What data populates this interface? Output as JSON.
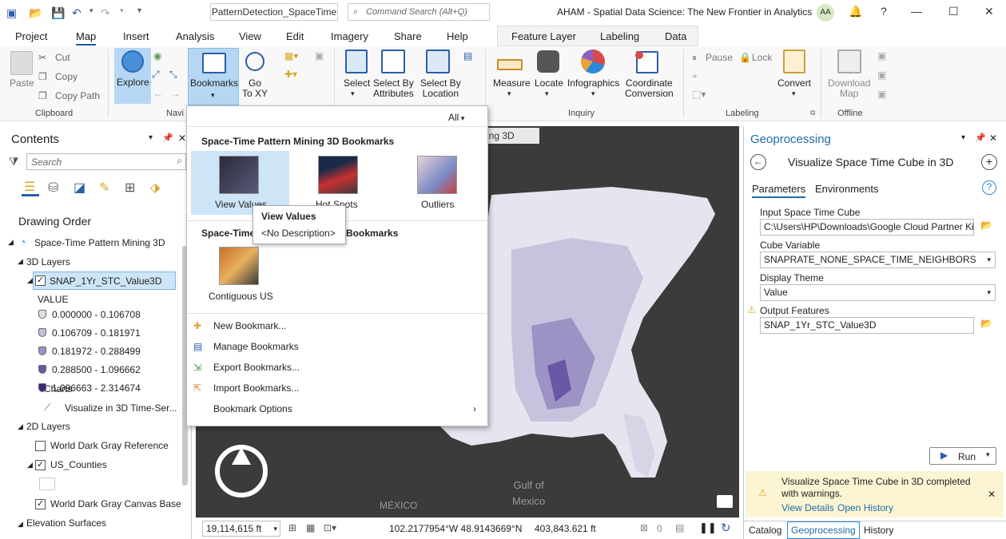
{
  "titlebar": {
    "doc_title": "PatternDetection_SpaceTime",
    "search_placeholder": "Command Search (Alt+Q)",
    "app_title": "AHAM - Spatial Data Science: The New Frontier in Analytics",
    "avatar": "AA",
    "help": "?"
  },
  "menu": {
    "tabs": [
      "Project",
      "Map",
      "Insert",
      "Analysis",
      "View",
      "Edit",
      "Imagery",
      "Share",
      "Help"
    ],
    "context_tabs": [
      "Feature Layer",
      "Labeling",
      "Data"
    ]
  },
  "ribbon": {
    "paste": "Paste",
    "cut": "Cut",
    "copy": "Copy",
    "copy_path": "Copy Path",
    "clipboard": "Clipboard",
    "explore": "Explore",
    "bookmarks": "Bookmarks",
    "go_to_xy": "Go\nTo XY",
    "navigate": "Navi",
    "select": "Select",
    "select_by_attributes": "Select By\nAttributes",
    "select_by_location": "Select By\nLocation",
    "measure": "Measure",
    "locate": "Locate",
    "infographics": "Infographics",
    "coordinate_conversion": "Coordinate\nConversion",
    "inquiry": "Inquiry",
    "pause": "Pause",
    "lock": "Lock",
    "labeling": "Labeling",
    "convert": "Convert",
    "download_map": "Download\nMap",
    "offline": "Offline"
  },
  "contents": {
    "title": "Contents",
    "search_placeholder": "Search",
    "drawing_order": "Drawing Order",
    "map_name": "Space-Time Pattern Mining 3D",
    "layers_3d": "3D Layers",
    "layer_3d": "SNAP_1Yr_STC_Value3D",
    "value_label": "VALUE",
    "classes": [
      {
        "label": "0.000000 - 0.106708",
        "color": "#e0e0e6"
      },
      {
        "label": "0.106709 - 0.181971",
        "color": "#c4c0da"
      },
      {
        "label": "0.181972 - 0.288499",
        "color": "#9d92c4"
      },
      {
        "label": "0.288500 - 1.096662",
        "color": "#6a57a6"
      },
      {
        "label": "1.096663 - 2.314674",
        "color": "#3d2478"
      }
    ],
    "charts": "Charts",
    "chart_item": "Visualize in 3D Time-Ser...",
    "layers_2d": "2D Layers",
    "layer_ref": "World Dark Gray Reference",
    "layer_counties": "US_Counties",
    "layer_base": "World Dark Gray Canvas Base",
    "elevation": "Elevation Surfaces"
  },
  "map": {
    "tab_fragment": "ing 3D",
    "gulf_label": "Gulf of\nMexico",
    "mexico_label": "MÉXICO",
    "scale": "19,114,615 ft",
    "coords": "102.2177954°W 48.9143669°N",
    "elevation": "403,843.621 ft",
    "selected_count": "0"
  },
  "bookmarks_menu": {
    "filter": "All",
    "section1": "Space-Time Pattern Mining 3D Bookmarks",
    "items1": [
      "View Values",
      "Hot Spots",
      "Outliers"
    ],
    "section2_prefix": "Space-Time",
    "section2_suffix": "Bookmarks",
    "items2": [
      "Contiguous US"
    ],
    "new": "New Bookmark...",
    "manage": "Manage Bookmarks",
    "export": "Export Bookmarks...",
    "import": "Import Bookmarks...",
    "options": "Bookmark Options",
    "tooltip_title": "View Values",
    "tooltip_desc": "<No Description>"
  },
  "geoprocessing": {
    "title": "Geoprocessing",
    "tool_title": "Visualize Space Time Cube in 3D",
    "tab_parameters": "Parameters",
    "tab_environments": "Environments",
    "input_label": "Input Space Time Cube",
    "input_value": "C:\\Users\\HP\\Downloads\\Google Cloud Partner Ki",
    "cube_var_label": "Cube Variable",
    "cube_var_value": "SNAPRATE_NONE_SPACE_TIME_NEIGHBORS",
    "theme_label": "Display Theme",
    "theme_value": "Value",
    "output_label": "Output Features",
    "output_value": "SNAP_1Yr_STC_Value3D",
    "run": "Run",
    "message": "Visualize Space Time Cube in 3D completed with warnings.",
    "view_details": "View Details",
    "open_history": "Open History",
    "bottom_tabs": [
      "Catalog",
      "Geoprocessing",
      "History"
    ]
  }
}
